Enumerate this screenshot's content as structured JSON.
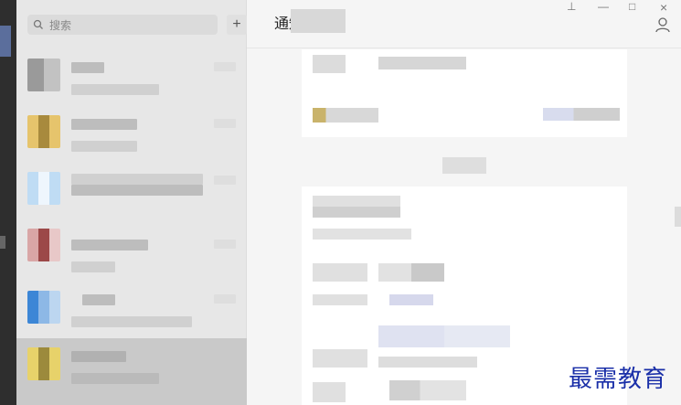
{
  "search": {
    "placeholder": "搜索"
  },
  "list": {
    "add_label": "+"
  },
  "chat": {
    "title": "通知"
  },
  "window": {
    "pin": "⊥",
    "minimize": "—",
    "maximize": "□",
    "close": "×"
  },
  "watermark": "最需教育",
  "colors": {
    "accent": "#1a2fa8",
    "list_bg": "#e7e7e7",
    "selected_bg": "#c9c9c9",
    "chat_bg": "#f5f5f5"
  }
}
